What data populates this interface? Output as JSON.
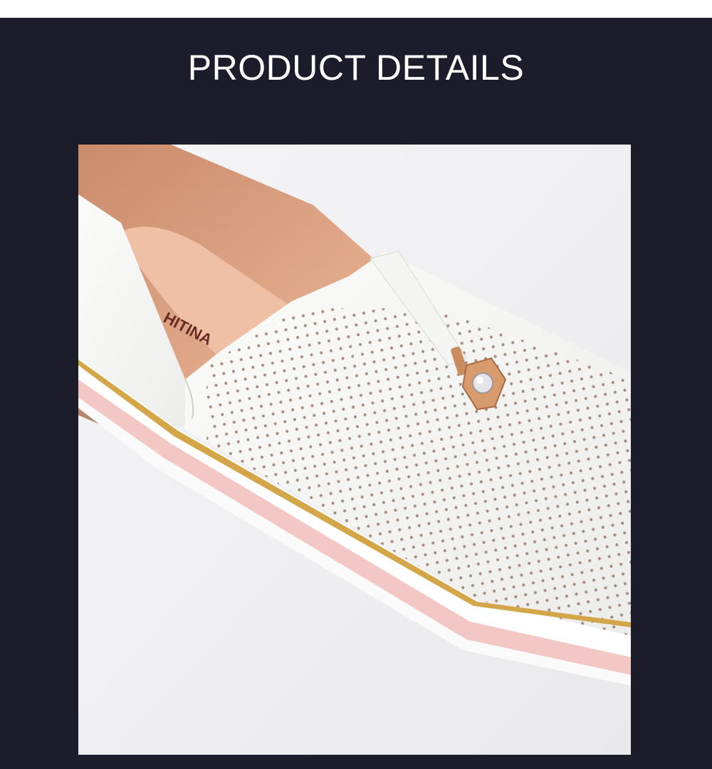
{
  "header": {
    "title": "PRODUCT DETAILS"
  },
  "photo": {
    "description_label": "product-photo",
    "insole_brand_text": "HITINA"
  },
  "colors": {
    "banner": "#1d1c2b",
    "leather": "#f7f7f6",
    "lining": "#e8b096",
    "sole_pink": "#f3c7c3",
    "gold_trim": "#d3a64a"
  }
}
